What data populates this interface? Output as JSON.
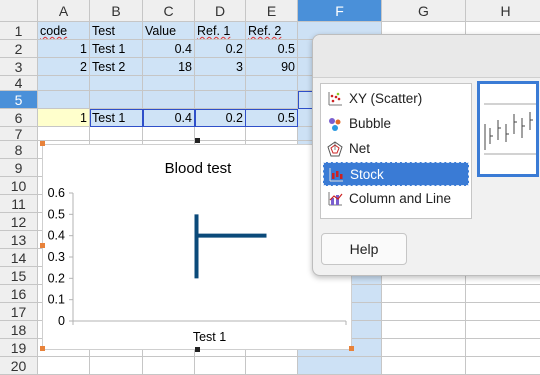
{
  "columns": [
    "A",
    "B",
    "C",
    "D",
    "E",
    "F",
    "G",
    "H"
  ],
  "selected_column": "F",
  "rows": [
    "1",
    "2",
    "3",
    "4",
    "5",
    "6",
    "7",
    "8",
    "9",
    "10",
    "11",
    "12",
    "13",
    "14",
    "15",
    "16",
    "17",
    "18",
    "19",
    "20"
  ],
  "selected_row": "5",
  "cells": {
    "header": {
      "code": "code",
      "test": "Test",
      "value": "Value",
      "ref1": "Ref. 1",
      "ref2": "Ref. 2"
    },
    "row2": {
      "code": "1",
      "test": "Test 1",
      "value": "0.4",
      "ref1": "0.2",
      "ref2": "0.5"
    },
    "row3": {
      "code": "2",
      "test": "Test 2",
      "value": "18",
      "ref1": "3",
      "ref2": "90"
    },
    "row6": {
      "code": "1",
      "test": "Test 1",
      "value": "0.4",
      "ref1": "0.2",
      "ref2": "0.5"
    }
  },
  "chart_data": {
    "type": "stock",
    "title": "Blood test",
    "categories": [
      "Test 1"
    ],
    "y_ticks": [
      "0.6",
      "0.5",
      "0.4",
      "0.3",
      "0.2",
      "0.1",
      "0"
    ],
    "ylim": [
      0,
      0.6
    ],
    "series": [
      {
        "low": 0.2,
        "high": 0.5,
        "close": 0.4
      }
    ],
    "color": "#0b4a7a"
  },
  "dialog": {
    "chart_types": [
      {
        "label": "XY (Scatter)",
        "icon": "scatter-icon"
      },
      {
        "label": "Bubble",
        "icon": "bubble-icon"
      },
      {
        "label": "Net",
        "icon": "net-icon"
      },
      {
        "label": "Stock",
        "icon": "stock-icon"
      },
      {
        "label": "Column and Line",
        "icon": "column-line-icon"
      }
    ],
    "selected": "Stock",
    "help_label": "Help"
  }
}
